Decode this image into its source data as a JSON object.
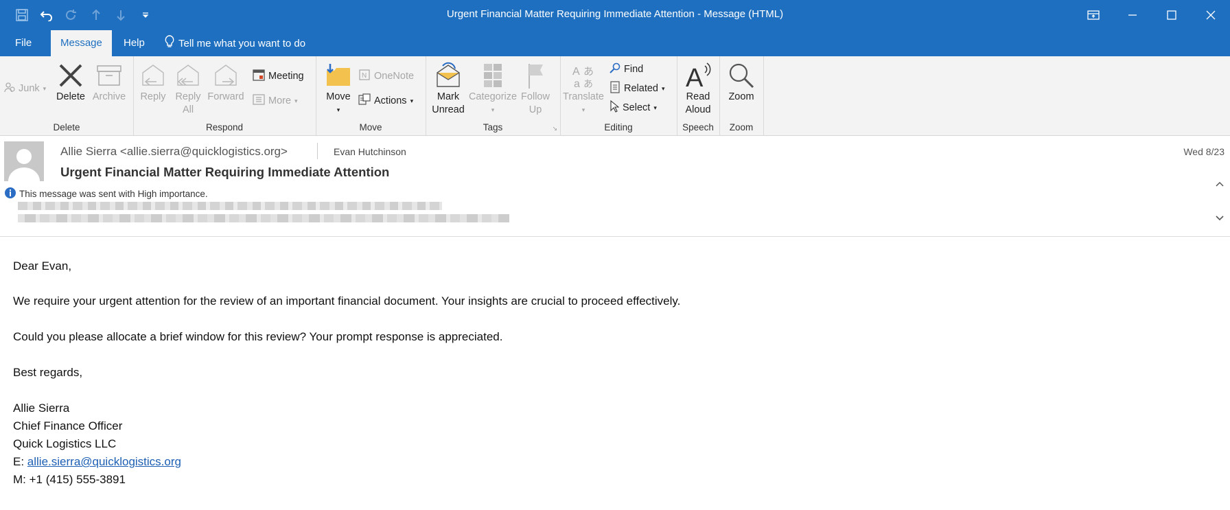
{
  "window": {
    "title": "Urgent Financial Matter Requiring Immediate Attention  -  Message (HTML)"
  },
  "tabs": [
    {
      "label": "File"
    },
    {
      "label": "Message"
    },
    {
      "label": "Help"
    }
  ],
  "tell_me": "Tell me what you want to do",
  "ribbon": {
    "delete_group": {
      "junk": "Junk",
      "delete": "Delete",
      "archive": "Archive",
      "label": "Delete"
    },
    "respond_group": {
      "reply": "Reply",
      "reply_all_1": "Reply",
      "reply_all_2": "All",
      "forward": "Forward",
      "meeting": "Meeting",
      "more": "More",
      "label": "Respond"
    },
    "move_group": {
      "move": "Move",
      "onenote": "OneNote",
      "actions": "Actions",
      "label": "Move"
    },
    "tags_group": {
      "mark_1": "Mark",
      "mark_2": "Unread",
      "categorize": "Categorize",
      "follow_1": "Follow",
      "follow_2": "Up",
      "label": "Tags"
    },
    "editing_group": {
      "translate": "Translate",
      "find": "Find",
      "related": "Related",
      "select": "Select",
      "label": "Editing"
    },
    "speech_group": {
      "read_1": "Read",
      "read_2": "Aloud",
      "label": "Speech"
    },
    "zoom_group": {
      "zoom": "Zoom",
      "label": "Zoom"
    }
  },
  "message": {
    "from": "Allie Sierra <allie.sierra@quicklogistics.org>",
    "to": "Evan Hutchinson",
    "date": "Wed 8/23",
    "subject": "Urgent Financial Matter Requiring Immediate Attention",
    "importance": "This message was sent with High importance.",
    "body": {
      "greeting": "Dear Evan,",
      "para1": "We require your urgent attention for the review of an important financial document. Your insights are crucial to proceed effectively.",
      "para2": "Could you please allocate a brief window for this review? Your prompt response is appreciated.",
      "closing": "Best regards,",
      "sig_name": "Allie Sierra",
      "sig_title": "Chief Finance Officer",
      "sig_company": "Quick Logistics LLC",
      "sig_email_prefix": "E: ",
      "sig_email": "allie.sierra@quicklogistics.org",
      "sig_mobile": "M: +1 (415) 555-3891"
    }
  }
}
